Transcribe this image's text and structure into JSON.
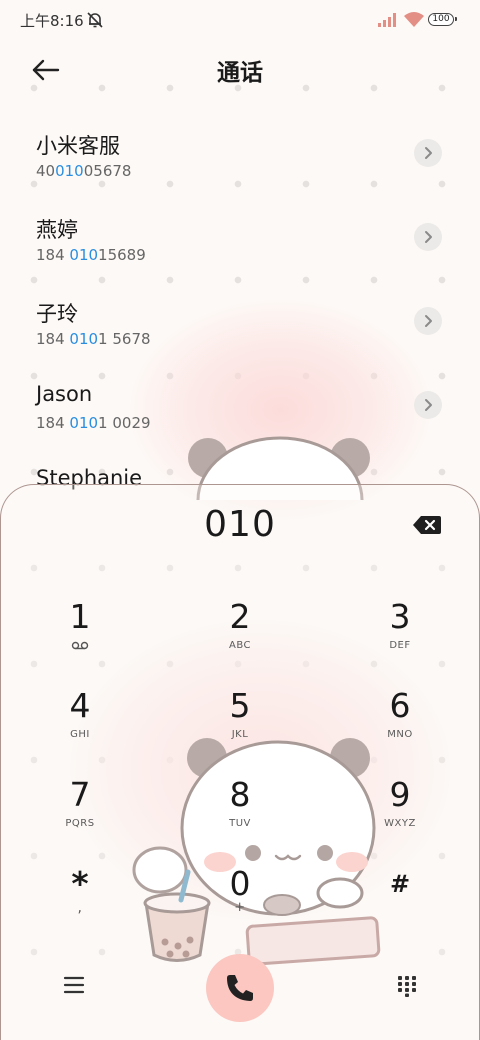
{
  "status_bar": {
    "time": "上午8:16",
    "battery": "100"
  },
  "header": {
    "title": "通话",
    "back_icon": "arrow-left-icon"
  },
  "contacts": [
    {
      "name": "小米客服",
      "number_pre": "40",
      "number_match": "010",
      "number_post": "05678"
    },
    {
      "name": "燕婷",
      "number_pre": "184 ",
      "number_match": "010",
      "number_post": "15689"
    },
    {
      "name": "子玲",
      "number_pre": "184 ",
      "number_match": "010",
      "number_post": "1 5678"
    },
    {
      "name": "Jason",
      "number_pre": "184 ",
      "number_match": "010",
      "number_post": "1 0029"
    },
    {
      "name": "Stephanie"
    }
  ],
  "dialer": {
    "input": "010",
    "keys": [
      {
        "digit": "1",
        "letters": ""
      },
      {
        "digit": "2",
        "letters": "ABC"
      },
      {
        "digit": "3",
        "letters": "DEF"
      },
      {
        "digit": "4",
        "letters": "GHI"
      },
      {
        "digit": "5",
        "letters": "JKL"
      },
      {
        "digit": "6",
        "letters": "MNO"
      },
      {
        "digit": "7",
        "letters": "PQRS"
      },
      {
        "digit": "8",
        "letters": "TUV"
      },
      {
        "digit": "9",
        "letters": "WXYZ"
      },
      {
        "digit": "*",
        "letters": ","
      },
      {
        "digit": "0",
        "letters": "+"
      },
      {
        "digit": "#",
        "letters": ""
      }
    ]
  },
  "bottom_bar": {
    "menu_icon": "menu-icon",
    "call_icon": "phone-icon",
    "keypad_icon": "dialpad-icon"
  },
  "colors": {
    "highlight": "#2a8ee0",
    "call_button": "#fbc7c0",
    "background": "#fdf9f6"
  }
}
